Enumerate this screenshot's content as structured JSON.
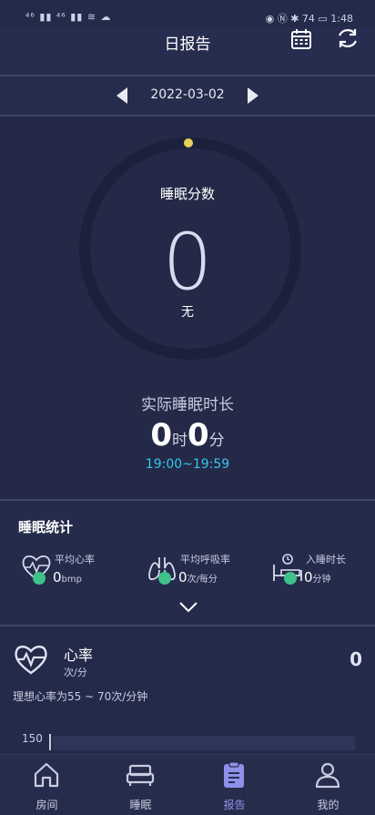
{
  "status_bar": {
    "left": "⁴⁶ ▮▮ ⁴⁶ ▮▮ ≋ ☁",
    "right": "◉ Ⓝ ✱ 74 ▭ 1:48"
  },
  "header": {
    "title": "日报告",
    "icons": [
      "calendar-icon",
      "refresh-icon"
    ]
  },
  "date_bar": {
    "date": "2022-03-02"
  },
  "score": {
    "label": "睡眠分数",
    "value": "0",
    "grade": "无",
    "ring_color": "#1c213b",
    "dot_color": "#e9d05a"
  },
  "actual_sleep": {
    "label": "实际睡眠时长",
    "hours": "0",
    "hour_unit": "时",
    "minutes": "0",
    "minute_unit": "分",
    "range": "19:00~19:59"
  },
  "stats": {
    "title": "睡眠统计",
    "items": [
      {
        "label": "平均心率",
        "value": "0",
        "unit": "bmp",
        "icon": "heart-pulse-icon"
      },
      {
        "label": "平均呼吸率",
        "value": "0",
        "unit": "次/每分",
        "icon": "lungs-icon"
      },
      {
        "label": "入睡时长",
        "value": "0",
        "unit": "分钟",
        "icon": "bed-clock-icon"
      }
    ]
  },
  "heart_rate": {
    "name": "心率",
    "unit": "次/分",
    "value": "0",
    "hint": "理想心率为55 ~ 70次/分钟",
    "axis_top": "150"
  },
  "nav": [
    {
      "label": "房间",
      "icon": "home-icon",
      "active": false
    },
    {
      "label": "睡眠",
      "icon": "bed-icon",
      "active": false
    },
    {
      "label": "报告",
      "icon": "report-icon",
      "active": true
    },
    {
      "label": "我的",
      "icon": "profile-icon",
      "active": false
    }
  ],
  "colors": {
    "accent": "#8d91ea",
    "cyan": "#37c6f0",
    "check": "#3fc18a",
    "background": "#242a4a"
  }
}
